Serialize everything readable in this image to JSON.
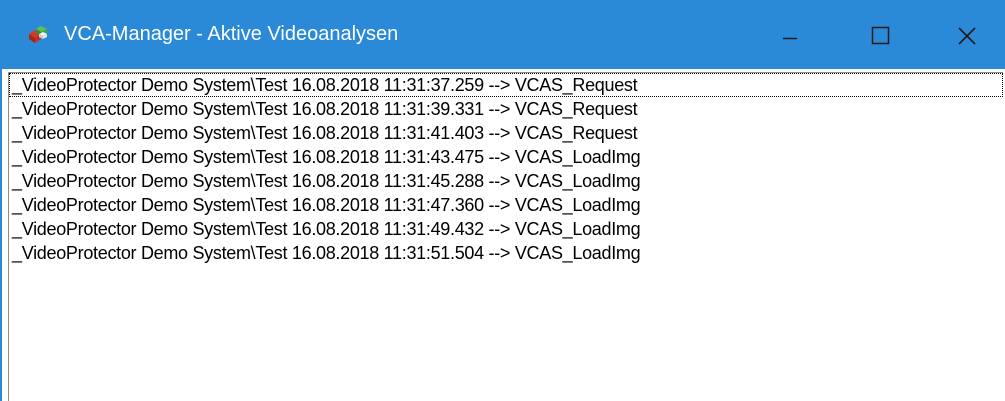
{
  "window": {
    "title": "VCA-Manager - Aktive Videoanalysen",
    "title_bar_color": "#2b8ad8",
    "app_icon": "vca-manager-app-icon",
    "controls": {
      "minimize_icon": "minimize-icon",
      "maximize_icon": "maximize-icon",
      "close_icon": "close-icon"
    }
  },
  "log_list": {
    "items": [
      "_VideoProtector Demo System\\Test 16.08.2018 11:31:37.259 --> VCAS_Request",
      "_VideoProtector Demo System\\Test 16.08.2018 11:31:39.331 --> VCAS_Request",
      "_VideoProtector Demo System\\Test 16.08.2018 11:31:41.403 --> VCAS_Request",
      "_VideoProtector Demo System\\Test 16.08.2018 11:31:43.475 --> VCAS_LoadImg",
      "_VideoProtector Demo System\\Test 16.08.2018 11:31:45.288 --> VCAS_LoadImg",
      "_VideoProtector Demo System\\Test 16.08.2018 11:31:47.360 --> VCAS_LoadImg",
      "_VideoProtector Demo System\\Test 16.08.2018 11:31:49.432 --> VCAS_LoadImg",
      "_VideoProtector Demo System\\Test 16.08.2018 11:31:51.504 --> VCAS_LoadImg"
    ]
  }
}
